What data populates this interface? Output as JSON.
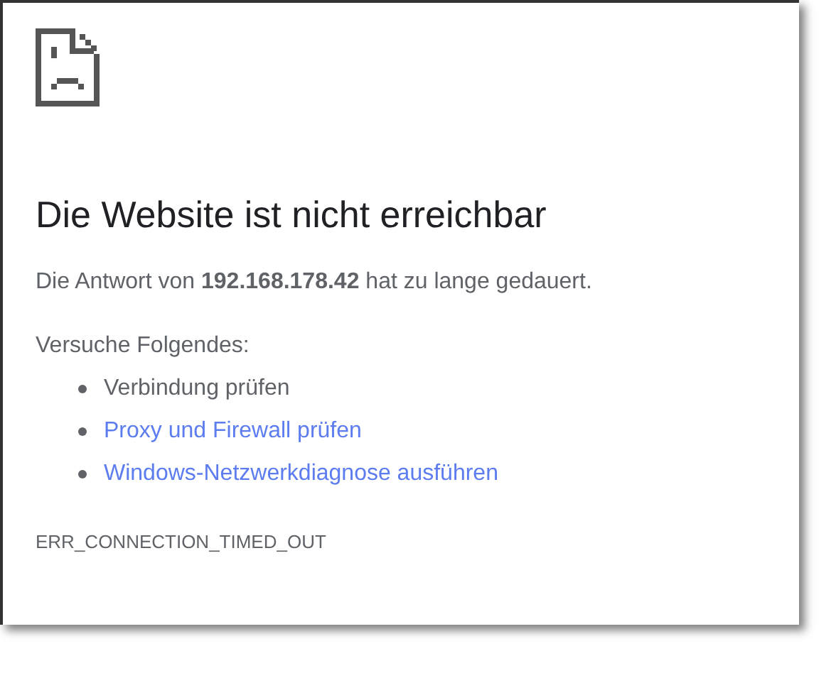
{
  "heading": "Die Website ist nicht erreichbar",
  "message": "Die Antwort von **192.168.178.42** hat zu lange gedauert.",
  "suggestions_title": "Versuche Folgendes:",
  "suggestions": [
    {
      "kind": "text",
      "label": "Verbindung prüfen"
    },
    {
      "kind": "link",
      "label": "Proxy und Firewall prüfen"
    },
    {
      "kind": "link",
      "label": "Windows-Netzwerkdiagnose ausführen"
    }
  ],
  "error_code": "ERR_CONNECTION_TIMED_OUT"
}
